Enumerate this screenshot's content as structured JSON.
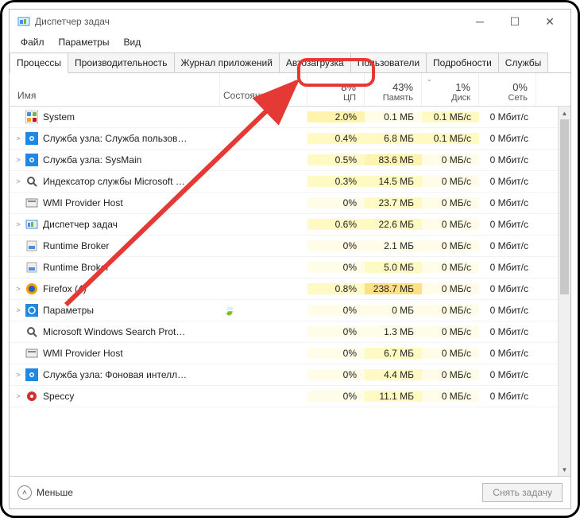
{
  "window": {
    "title": "Диспетчер задач"
  },
  "menu": {
    "file": "Файл",
    "options": "Параметры",
    "view": "Вид"
  },
  "tabs": {
    "t0": "Процессы",
    "t1": "Производительность",
    "t2": "Журнал приложений",
    "t3": "Автозагрузка",
    "t4": "Пользователи",
    "t5": "Подробности",
    "t6": "Службы"
  },
  "headers": {
    "name": "Имя",
    "state": "Состояние",
    "cpu_pct": "8%",
    "cpu_lbl": "ЦП",
    "mem_pct": "43%",
    "mem_lbl": "Память",
    "disk_pct": "1%",
    "disk_lbl": "Диск",
    "net_pct": "0%",
    "net_lbl": "Сеть"
  },
  "rows": [
    {
      "exp": "",
      "name": "System",
      "cpu": "2.0%",
      "mem": "0.1 МБ",
      "disk": "0.1 МБ/с",
      "net": "0 Мбит/с",
      "ch": 2,
      "mh": 0,
      "dh": 1,
      "icon": "sys"
    },
    {
      "exp": ">",
      "name": "Служба узла: Служба пользов…",
      "cpu": "0.4%",
      "mem": "6.8 МБ",
      "disk": "0.1 МБ/с",
      "net": "0 Мбит/с",
      "ch": 1,
      "mh": 1,
      "dh": 1,
      "icon": "gear"
    },
    {
      "exp": ">",
      "name": "Служба узла: SysMain",
      "cpu": "0.5%",
      "mem": "83.6 МБ",
      "disk": "0 МБ/с",
      "net": "0 Мбит/с",
      "ch": 1,
      "mh": 2,
      "dh": 0,
      "icon": "gear"
    },
    {
      "exp": ">",
      "name": "Индексатор службы Microsoft …",
      "cpu": "0.3%",
      "mem": "14.5 МБ",
      "disk": "0 МБ/с",
      "net": "0 Мбит/с",
      "ch": 1,
      "mh": 1,
      "dh": 0,
      "icon": "search"
    },
    {
      "exp": "",
      "name": "WMI Provider Host",
      "cpu": "0%",
      "mem": "23.7 МБ",
      "disk": "0 МБ/с",
      "net": "0 Мбит/с",
      "ch": 0,
      "mh": 1,
      "dh": 0,
      "icon": "wmi"
    },
    {
      "exp": ">",
      "name": "Диспетчер задач",
      "cpu": "0.6%",
      "mem": "22.6 МБ",
      "disk": "0 МБ/с",
      "net": "0 Мбит/с",
      "ch": 1,
      "mh": 1,
      "dh": 0,
      "icon": "tm"
    },
    {
      "exp": "",
      "name": "Runtime Broker",
      "cpu": "0%",
      "mem": "2.1 МБ",
      "disk": "0 МБ/с",
      "net": "0 Мбит/с",
      "ch": 0,
      "mh": 0,
      "dh": 0,
      "icon": "rb"
    },
    {
      "exp": "",
      "name": "Runtime Broker",
      "cpu": "0%",
      "mem": "5.0 МБ",
      "disk": "0 МБ/с",
      "net": "0 Мбит/с",
      "ch": 0,
      "mh": 1,
      "dh": 0,
      "icon": "rb"
    },
    {
      "exp": ">",
      "name": "Firefox (4)",
      "cpu": "0.8%",
      "mem": "238.7 МБ",
      "disk": "0 МБ/с",
      "net": "0 Мбит/с",
      "ch": 1,
      "mh": 3,
      "dh": 0,
      "icon": "ff"
    },
    {
      "exp": ">",
      "name": "Параметры",
      "cpu": "0%",
      "mem": "0 МБ",
      "disk": "0 МБ/с",
      "net": "0 Мбит/с",
      "ch": 0,
      "mh": 0,
      "dh": 0,
      "icon": "settings",
      "leaf": true
    },
    {
      "exp": "",
      "name": "Microsoft Windows Search Prot…",
      "cpu": "0%",
      "mem": "1.3 МБ",
      "disk": "0 МБ/с",
      "net": "0 Мбит/с",
      "ch": 0,
      "mh": 0,
      "dh": 0,
      "icon": "search"
    },
    {
      "exp": "",
      "name": "WMI Provider Host",
      "cpu": "0%",
      "mem": "6.7 МБ",
      "disk": "0 МБ/с",
      "net": "0 Мбит/с",
      "ch": 0,
      "mh": 1,
      "dh": 0,
      "icon": "wmi"
    },
    {
      "exp": ">",
      "name": "Служба узла: Фоновая интелл…",
      "cpu": "0%",
      "mem": "4.4 МБ",
      "disk": "0 МБ/с",
      "net": "0 Мбит/с",
      "ch": 0,
      "mh": 1,
      "dh": 0,
      "icon": "gear"
    },
    {
      "exp": ">",
      "name": "Speccy",
      "cpu": "0%",
      "mem": "11.1 МБ",
      "disk": "0 МБ/с",
      "net": "0 Мбит/с",
      "ch": 0,
      "mh": 1,
      "dh": 0,
      "icon": "speccy"
    }
  ],
  "footer": {
    "fewer": "Меньше",
    "endtask": "Снять задачу"
  }
}
